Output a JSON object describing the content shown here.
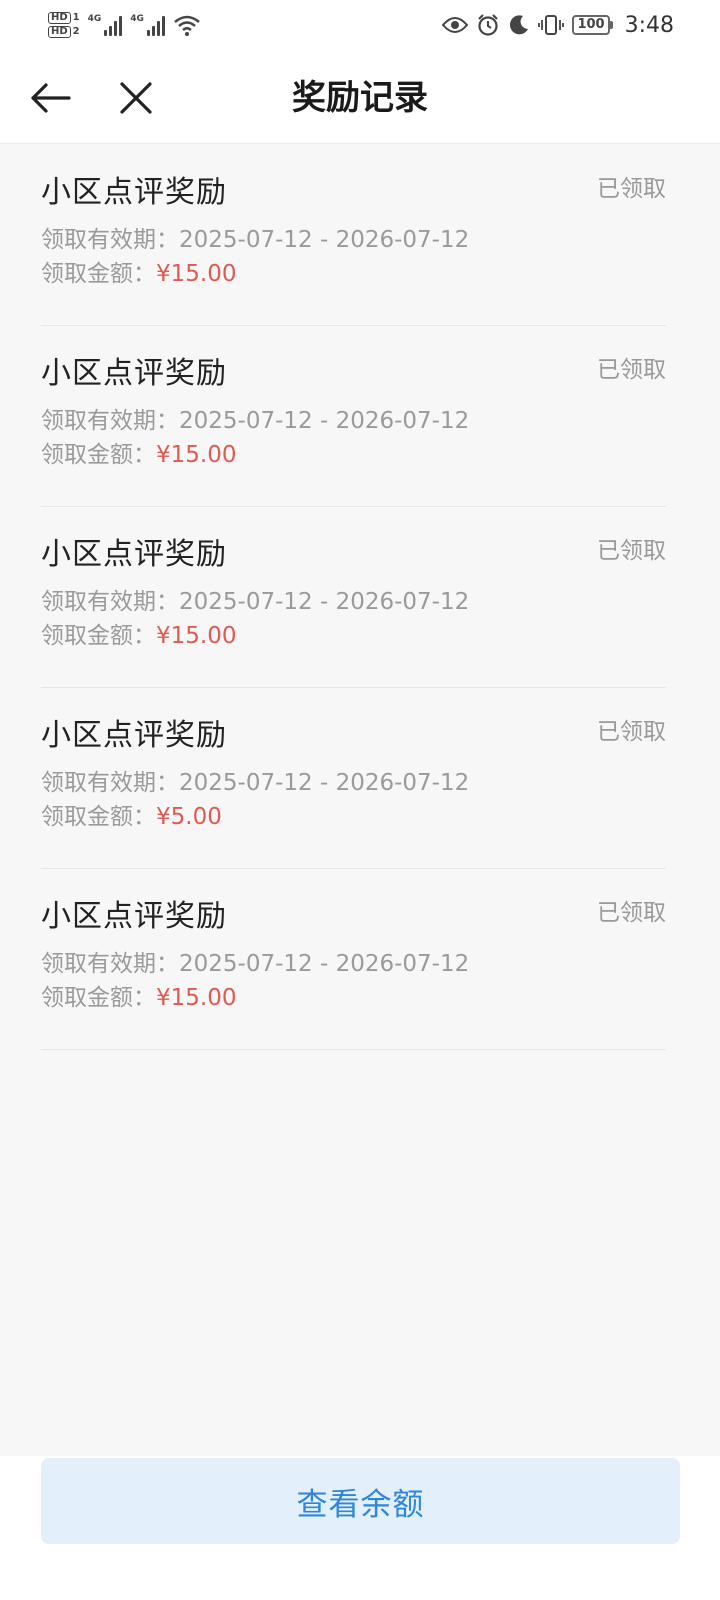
{
  "status_bar": {
    "hd1": "HD",
    "hd1_sub": "1",
    "hd2": "HD",
    "hd2_sub": "2",
    "net1": "4G",
    "net2": "4G",
    "battery": "100",
    "time": "3:48"
  },
  "header": {
    "title": "奖励记录"
  },
  "rewards": [
    {
      "title": "小区点评奖励",
      "status": "已领取",
      "validity_label": "领取有效期：",
      "validity": "2025-07-12 - 2026-07-12",
      "amount_label": "领取金额：",
      "amount": "¥15.00"
    },
    {
      "title": "小区点评奖励",
      "status": "已领取",
      "validity_label": "领取有效期：",
      "validity": "2025-07-12 - 2026-07-12",
      "amount_label": "领取金额：",
      "amount": "¥15.00"
    },
    {
      "title": "小区点评奖励",
      "status": "已领取",
      "validity_label": "领取有效期：",
      "validity": "2025-07-12 - 2026-07-12",
      "amount_label": "领取金额：",
      "amount": "¥15.00"
    },
    {
      "title": "小区点评奖励",
      "status": "已领取",
      "validity_label": "领取有效期：",
      "validity": "2025-07-12 - 2026-07-12",
      "amount_label": "领取金额：",
      "amount": "¥5.00"
    },
    {
      "title": "小区点评奖励",
      "status": "已领取",
      "validity_label": "领取有效期：",
      "validity": "2025-07-12 - 2026-07-12",
      "amount_label": "领取金额：",
      "amount": "¥15.00"
    }
  ],
  "bottom": {
    "balance_button_label": "查看余额"
  },
  "colors": {
    "amount": "#e05a52",
    "button_bg": "#e3f0fb",
    "button_text": "#2f86d6"
  }
}
